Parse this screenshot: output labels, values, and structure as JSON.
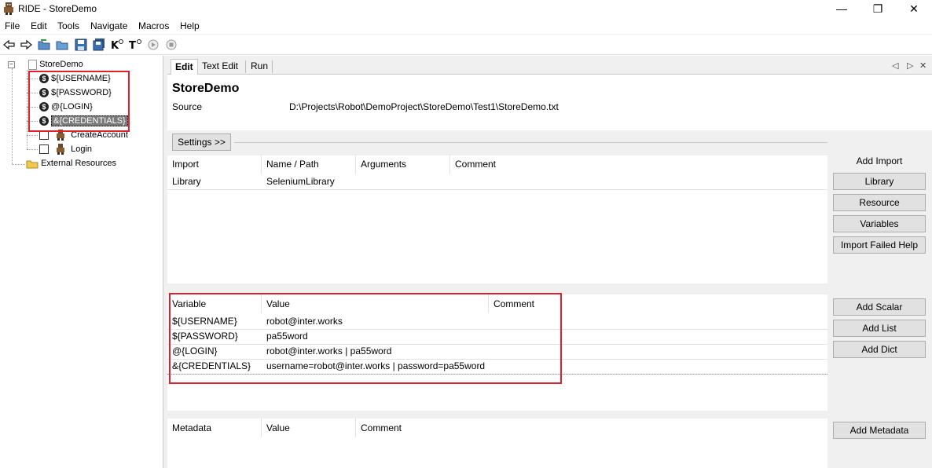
{
  "window": {
    "title": "RIDE - StoreDemo",
    "minimize": "—",
    "restore": "❐",
    "close": "✕"
  },
  "menu": [
    "File",
    "Edit",
    "Tools",
    "Navigate",
    "Macros",
    "Help"
  ],
  "tree": {
    "root": "StoreDemo",
    "variables": [
      "${USERNAME}",
      "${PASSWORD}",
      "@{LOGIN}",
      "&{CREDENTIALS}"
    ],
    "tests": [
      "CreateAccount",
      "Login"
    ],
    "external": "External Resources"
  },
  "tabs": [
    "Edit",
    "Text Edit",
    "Run"
  ],
  "tab_controls": [
    "◁",
    "▷",
    "✕"
  ],
  "editor": {
    "suite_name": "StoreDemo",
    "source_label": "Source",
    "source_path": "D:\\Projects\\Robot\\DemoProject\\StoreDemo\\Test1\\StoreDemo.txt",
    "settings_button": "Settings >>"
  },
  "imports": {
    "headers": [
      "Import",
      "Name / Path",
      "Arguments",
      "Comment"
    ],
    "rows": [
      [
        "Library",
        "SeleniumLibrary",
        "",
        ""
      ]
    ],
    "side_label": "Add Import",
    "buttons": [
      "Library",
      "Resource",
      "Variables",
      "Import Failed Help"
    ]
  },
  "variables": {
    "headers": [
      "Variable",
      "Value",
      "Comment"
    ],
    "rows": [
      [
        "${USERNAME}",
        "robot@inter.works",
        ""
      ],
      [
        "${PASSWORD}",
        "pa55word",
        ""
      ],
      [
        "@{LOGIN}",
        "robot@inter.works | pa55word",
        ""
      ],
      [
        "&{CREDENTIALS}",
        "username=robot@inter.works | password=pa55word",
        ""
      ]
    ],
    "buttons": [
      "Add Scalar",
      "Add List",
      "Add Dict"
    ]
  },
  "metadata": {
    "headers": [
      "Metadata",
      "Value",
      "Comment"
    ],
    "button": "Add Metadata"
  },
  "colors": {
    "highlight": "#e0202a",
    "selection": "#7a7a7a"
  }
}
